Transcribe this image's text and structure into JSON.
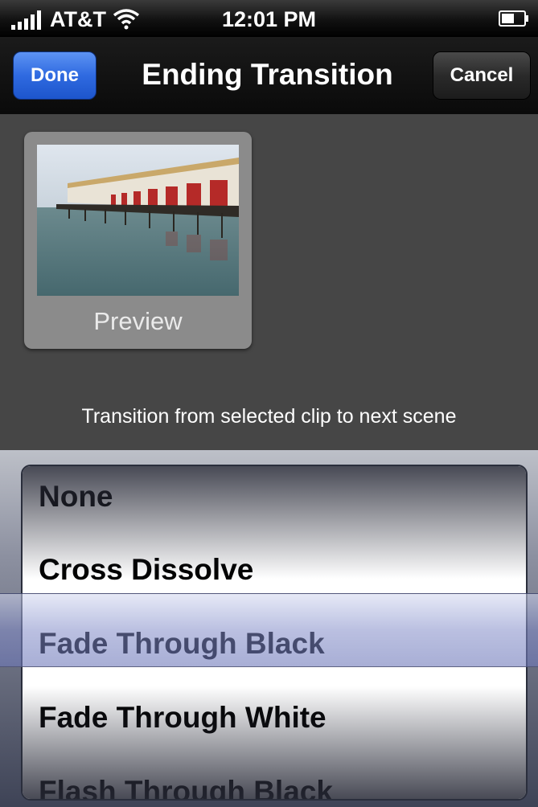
{
  "status_bar": {
    "carrier": "AT&T",
    "time": "12:01 PM",
    "signal_icon": "signal-bars-icon",
    "wifi_icon": "wifi-icon",
    "battery_icon": "battery-icon"
  },
  "nav": {
    "done_label": "Done",
    "title": "Ending Transition",
    "cancel_label": "Cancel"
  },
  "preview": {
    "label": "Preview"
  },
  "caption": "Transition from selected clip to next scene",
  "picker": {
    "items": [
      "None",
      "Cross Dissolve",
      "Fade Through Black",
      "Fade Through White",
      "Flash Through Black"
    ],
    "selected": "Fade Through Black"
  },
  "colors": {
    "done_button": "#2f6ae0",
    "content_background": "#464646",
    "selection_bar": "#8c96c8"
  }
}
